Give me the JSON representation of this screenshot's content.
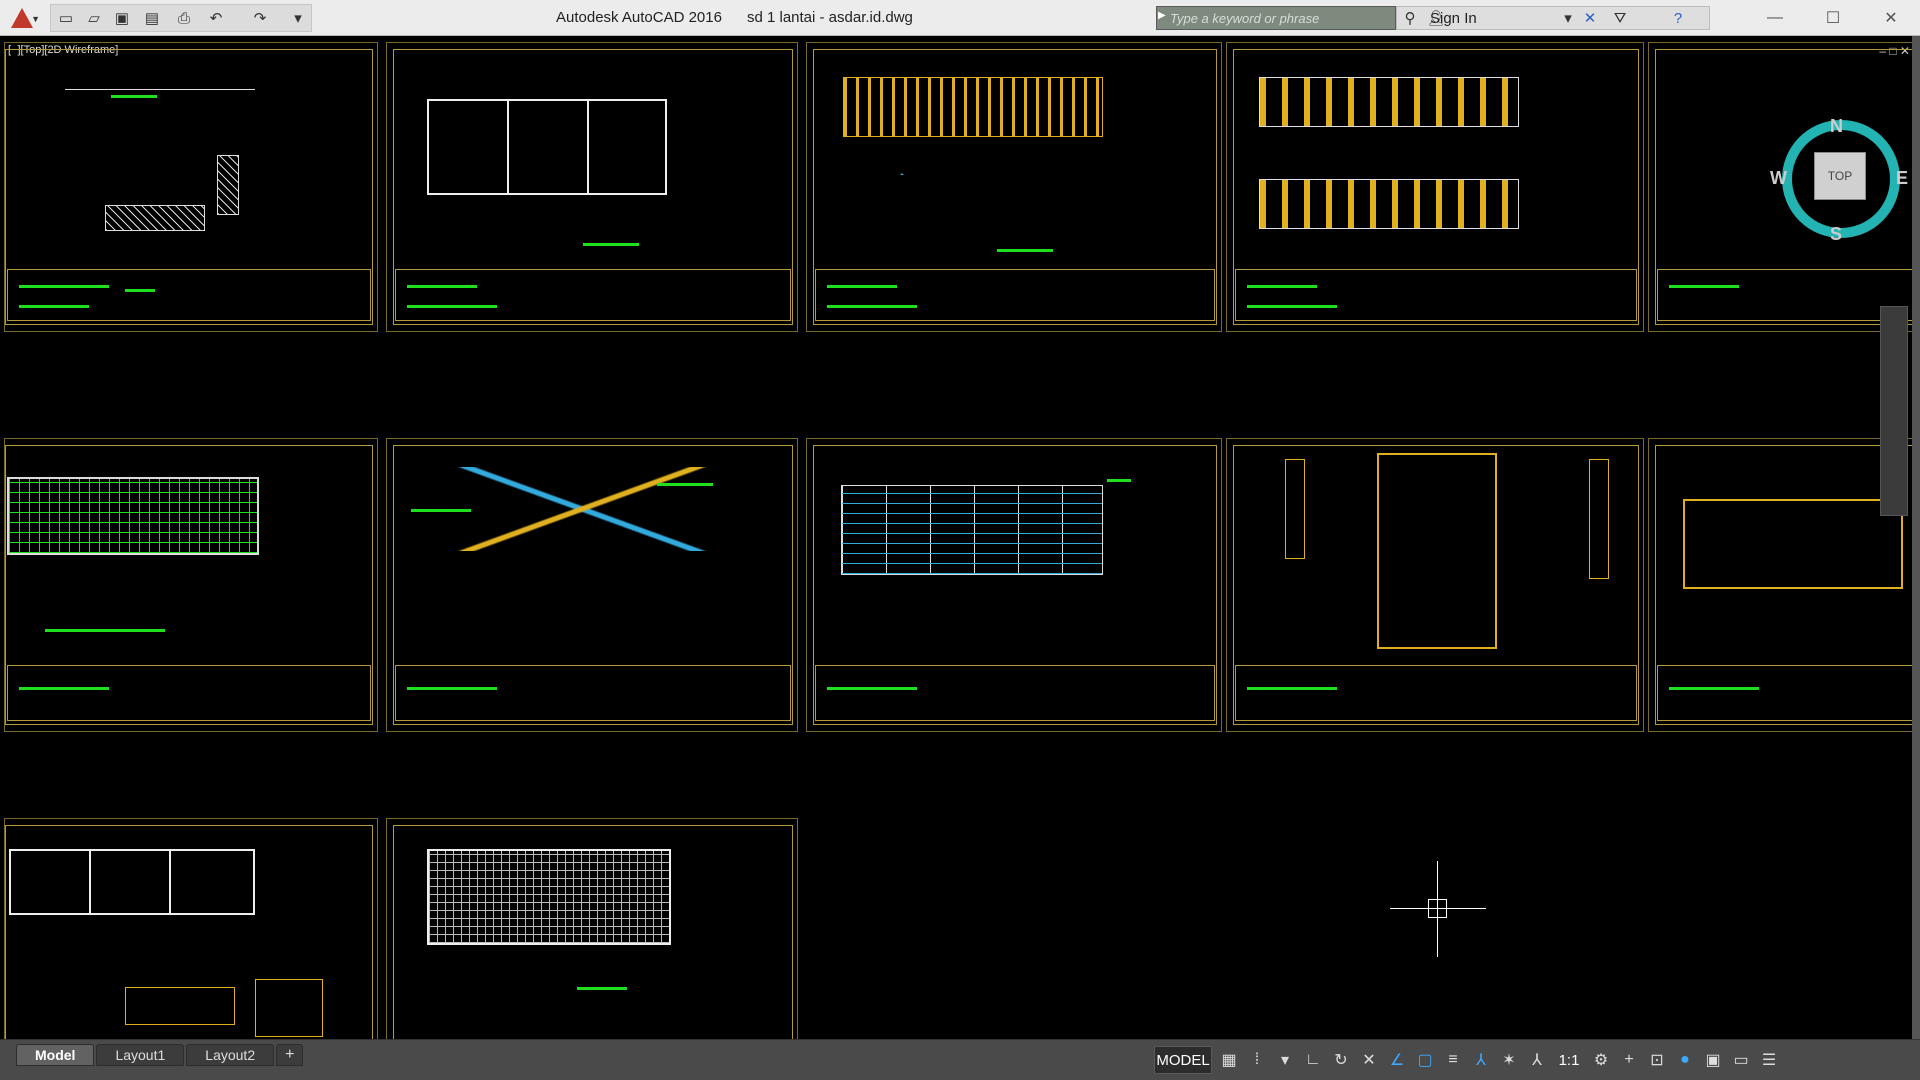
{
  "window": {
    "app_name": "Autodesk AutoCAD 2016",
    "file_name": "sd 1 lantai - asdar.id.dwg"
  },
  "quick_access": {
    "icons": [
      "new-icon",
      "open-icon",
      "save-icon",
      "save-as-icon",
      "print-icon",
      "undo-icon",
      "redo-icon",
      "customize-icon"
    ]
  },
  "search": {
    "placeholder": "Type a keyword or phrase"
  },
  "infocenter": {
    "signin_label": "Sign In",
    "icons": [
      "binoculars-icon",
      "user-icon",
      "exchange-icon",
      "a360-icon",
      "help-icon"
    ]
  },
  "viewport": {
    "label": "[−][Top][2D Wireframe]",
    "controls": "‒ □ ✕"
  },
  "viewcube": {
    "north": "N",
    "south": "S",
    "west": "W",
    "east": "E",
    "face": "TOP"
  },
  "tabs": [
    {
      "label": "Model",
      "active": true
    },
    {
      "label": "Layout1",
      "active": false
    },
    {
      "label": "Layout2",
      "active": false
    },
    {
      "label": "+",
      "active": false
    }
  ],
  "statusbar": {
    "model_label": "MODEL",
    "scale_label": "1:1",
    "icons": [
      "grid-icon",
      "snap-icon",
      "ortho-icon",
      "polar-icon",
      "osnap-icon",
      "otrack-icon",
      "lineweight-icon",
      "annotation-icon",
      "workspace-icon",
      "isolate-icon",
      "hardware-icon",
      "clean-screen-icon",
      "customize-icon"
    ]
  }
}
